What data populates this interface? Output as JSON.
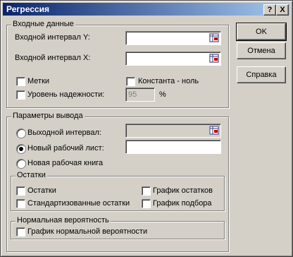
{
  "window": {
    "title": "Регрессия",
    "help_button": "?",
    "close_button": "X"
  },
  "buttons": {
    "ok": "OK",
    "cancel": "Отмена",
    "help": "Справка"
  },
  "input_group": {
    "title": "Входные данные",
    "y_label": "Входной интервал Y:",
    "x_label": "Входной интервал X:",
    "labels_check": "Метки",
    "constant_zero_check": "Константа - ноль",
    "confidence_check": "Уровень надежности:",
    "confidence_value": "95",
    "percent_sign": "%"
  },
  "output_group": {
    "title": "Параметры вывода",
    "output_range": "Выходной интервал:",
    "new_sheet": "Новый рабочий лист:",
    "new_workbook": "Новая рабочая книга",
    "selected": "new_sheet"
  },
  "residuals_group": {
    "title": "Остатки",
    "residuals": "Остатки",
    "standardized_residuals": "Стандартизованные остатки",
    "residual_plots": "График остатков",
    "line_fit_plots": "График подбора"
  },
  "normal_group": {
    "title": "Нормальная вероятность",
    "normal_plot": "График нормальной вероятности"
  }
}
